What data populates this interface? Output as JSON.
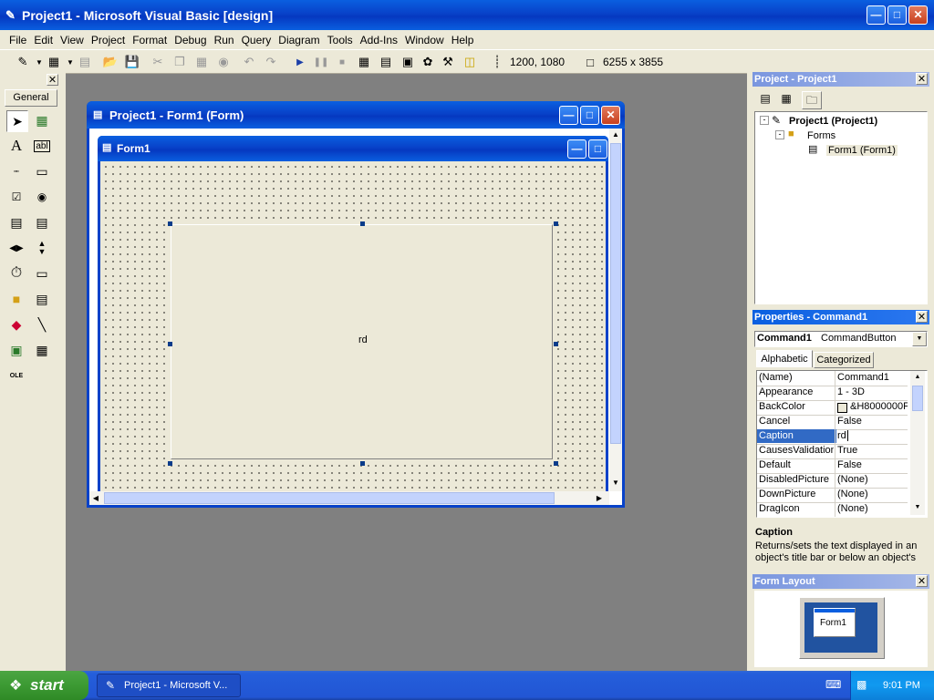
{
  "window": {
    "title": "Project1 - Microsoft Visual Basic [design]"
  },
  "menu": [
    "File",
    "Edit",
    "View",
    "Project",
    "Format",
    "Debug",
    "Run",
    "Query",
    "Diagram",
    "Tools",
    "Add-Ins",
    "Window",
    "Help"
  ],
  "toolbar": {
    "position": "1200, 1080",
    "size": "6255 x 3855"
  },
  "toolbox": {
    "tab_label": "General"
  },
  "form_designer": {
    "mdi_title": "Project1 - Form1 (Form)",
    "form_title": "Form1",
    "command_caption": "rd"
  },
  "project": {
    "title": "Project - Project1",
    "root": "Project1 (Project1)",
    "folder": "Forms",
    "form": "Form1 (Form1)"
  },
  "properties": {
    "title": "Properties - Command1",
    "object_name": "Command1",
    "object_type": "CommandButton",
    "tabs": [
      "Alphabetic",
      "Categorized"
    ],
    "rows": [
      {
        "name": "(Name)",
        "value": "Command1"
      },
      {
        "name": "Appearance",
        "value": "1 - 3D"
      },
      {
        "name": "BackColor",
        "value": "&H8000000F"
      },
      {
        "name": "Cancel",
        "value": "False"
      },
      {
        "name": "Caption",
        "value": "rd"
      },
      {
        "name": "CausesValidation",
        "value": "True"
      },
      {
        "name": "Default",
        "value": "False"
      },
      {
        "name": "DisabledPicture",
        "value": "(None)"
      },
      {
        "name": "DownPicture",
        "value": "(None)"
      },
      {
        "name": "DragIcon",
        "value": "(None)"
      }
    ],
    "desc_title": "Caption",
    "desc_text": "Returns/sets the text displayed in an object's title bar or below an object's"
  },
  "form_layout": {
    "title": "Form Layout",
    "form_label": "Form1"
  },
  "taskbar": {
    "start_label": "start",
    "task_label": "Project1 - Microsoft V...",
    "time": "9:01 PM"
  },
  "colors": {
    "xp_blue": "#0a5fe0",
    "panel_bg": "#ece9d8",
    "workspace": "#808080",
    "start_green": "#3c9a33"
  }
}
